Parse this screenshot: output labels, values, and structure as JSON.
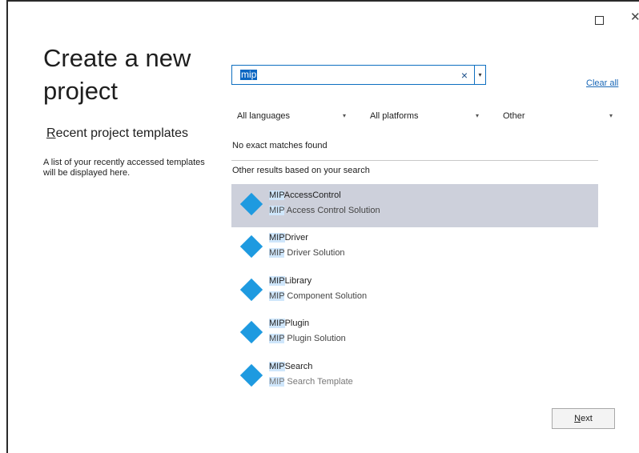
{
  "window": {
    "maximize_icon": "maximize-icon",
    "close_label": "✕"
  },
  "left": {
    "title_line1": "Create a new",
    "title_line2": "project",
    "recent_heading_first": "R",
    "recent_heading_rest": "ecent project templates",
    "recent_desc": "A list of your recently accessed templates will be displayed here."
  },
  "search": {
    "value": "mip",
    "clear_icon": "×",
    "dropdown_icon": "▾",
    "clear_all_first": "C",
    "clear_all_rest": "lear all"
  },
  "filters": {
    "language": "All languages",
    "platform": "All platforms",
    "type": "Other"
  },
  "results": {
    "no_match": "No exact matches found",
    "other_results": "Other results based on your search",
    "items": [
      {
        "name_hl": "MIP",
        "name_rest": "AccessControl",
        "desc_hl": "MIP",
        "desc_rest": " Access Control Solution"
      },
      {
        "name_hl": "MIP",
        "name_rest": "Driver",
        "desc_hl": "MIP",
        "desc_rest": " Driver Solution"
      },
      {
        "name_hl": "MIP",
        "name_rest": "Library",
        "desc_hl": "MIP",
        "desc_rest": " Component Solution"
      },
      {
        "name_hl": "MIP",
        "name_rest": "Plugin",
        "desc_hl": "MIP",
        "desc_rest": " Plugin Solution"
      },
      {
        "name_hl": "MIP",
        "name_rest": "Search",
        "desc_hl": "MIP",
        "desc_rest": " Search Template"
      }
    ]
  },
  "footer": {
    "next_first": "N",
    "next_rest": "ext"
  },
  "colors": {
    "accent": "#0a66c2",
    "selected_row": "#cdd0db",
    "template_icon": "#1e9ae0"
  }
}
